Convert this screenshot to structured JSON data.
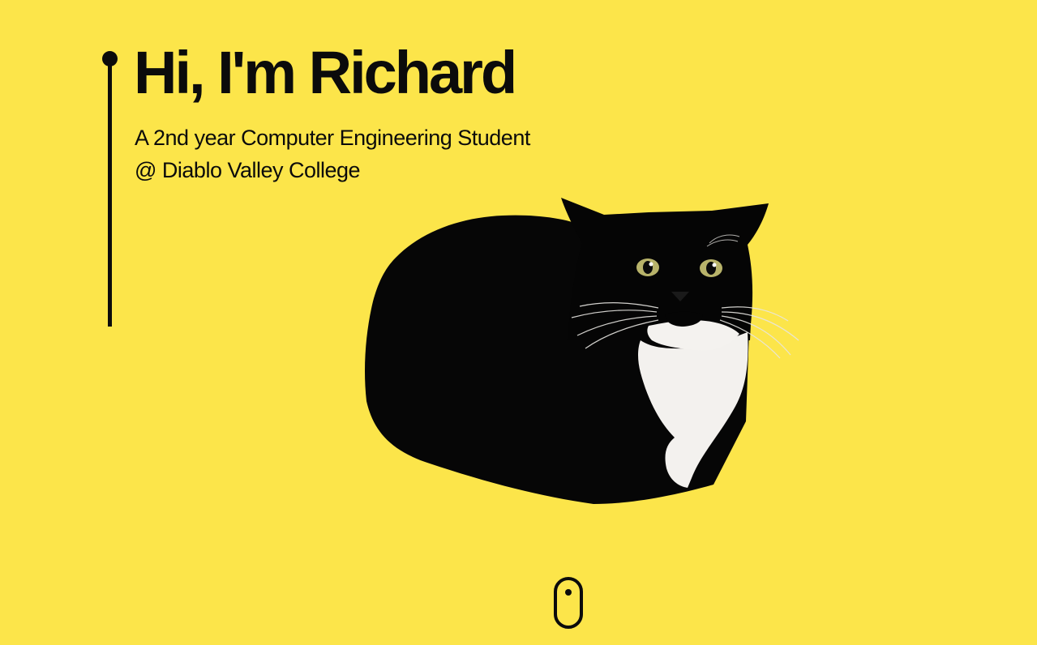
{
  "hero": {
    "title": "Hi, I'm Richard",
    "subtitle_line1": "A 2nd year Computer Engineering Student",
    "subtitle_line2": "@ Diablo Valley College",
    "image_icon": "tuxedo-cat-icon",
    "scroll_icon": "mouse-scroll-icon"
  },
  "colors": {
    "background": "#FCE54A",
    "text": "#0b0b0b"
  }
}
